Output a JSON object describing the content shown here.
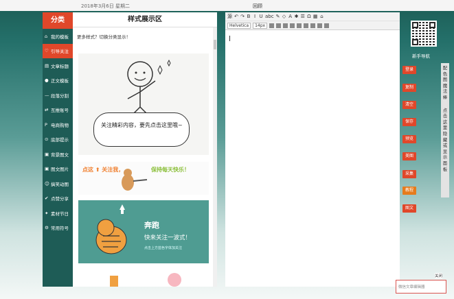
{
  "topbar": {
    "date": "2018年3月6日 星期二",
    "center": "回顾"
  },
  "categories": {
    "title": "分类",
    "items": [
      {
        "label": "我的模板",
        "icon": "home-icon"
      },
      {
        "label": "引导关注",
        "icon": "follow-icon",
        "active": true
      },
      {
        "label": "文章标题",
        "icon": "document-icon"
      },
      {
        "label": "正文模板",
        "icon": "circle-icon"
      },
      {
        "label": "段落分割",
        "icon": "dash-icon"
      },
      {
        "label": "互推账号",
        "icon": "share-icon"
      },
      {
        "label": "电商购物",
        "icon": "p-icon"
      },
      {
        "label": "底部提示",
        "icon": "bottom-icon"
      },
      {
        "label": "背景图文",
        "icon": "image-icon"
      },
      {
        "label": "图文图片",
        "icon": "picture-icon"
      },
      {
        "label": "搞笑动图",
        "icon": "gif-icon"
      },
      {
        "label": "点赞分享",
        "icon": "thumb-icon"
      },
      {
        "label": "素材节日",
        "icon": "gift-icon"
      },
      {
        "label": "常用符号",
        "icon": "symbol-icon"
      }
    ]
  },
  "style_panel": {
    "title": "样式展示区",
    "tip": "更多样式？切换分类显示！",
    "tpl1_text": "关注精彩内容，要先点击这里哦~",
    "tpl2_left": "点这 ⬆ 关注我，",
    "tpl2_right": "保持每天快乐！",
    "tpl3_head": "奔跑",
    "tpl3_line": "快来关注一波式！",
    "tpl3_small": "点击上方蓝色字体加关注"
  },
  "editor": {
    "toolbar1": [
      "源",
      "↶",
      "↷",
      "B",
      "I",
      "U",
      "abc",
      "✎",
      "◇",
      "A",
      "✱",
      "☰",
      "Ω",
      "▦",
      "⌂"
    ],
    "font_family": "Helvetica",
    "font_size": "14px"
  },
  "right_panel": {
    "guide": "新手导航",
    "buttons": [
      {
        "label": "登录",
        "alt": false
      },
      {
        "label": "复制",
        "alt": false
      },
      {
        "label": "清空",
        "alt": false
      },
      {
        "label": "保存",
        "alt": false
      },
      {
        "label": "预览",
        "alt": false
      },
      {
        "label": "美图",
        "alt": false
      },
      {
        "label": "采集",
        "alt": false
      },
      {
        "label": "教程",
        "alt": true
      },
      {
        "label": "图文",
        "alt": false
      }
    ],
    "side_tab_top": "配色图 魔法棒",
    "side_tab_bottom": "点击这里隐藏或显示面板",
    "wechat_label": "关闭",
    "wechat_placeholder": "微信文章编辑器"
  },
  "colors": {
    "accent": "#e0472a",
    "sidebar": "#1e5c56",
    "teal": "#4f9c92"
  }
}
